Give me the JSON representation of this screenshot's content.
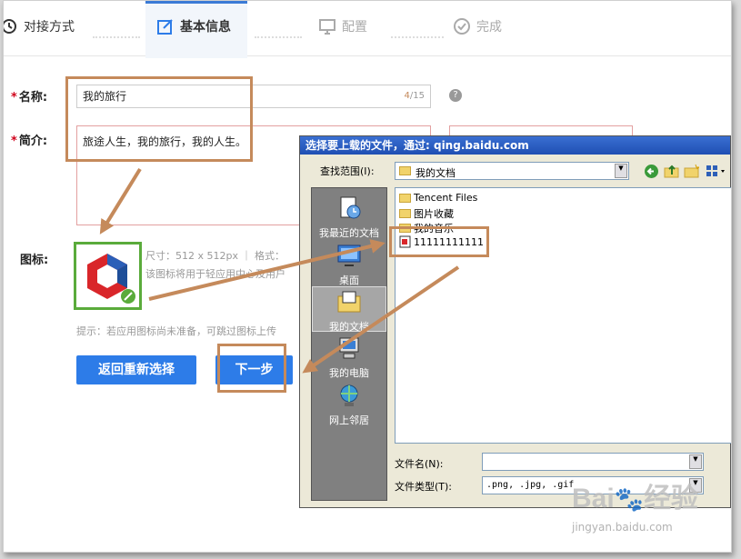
{
  "steps": [
    {
      "label": "对接方式",
      "state": "done",
      "icon": "history-icon"
    },
    {
      "label": "基本信息",
      "state": "active",
      "icon": "edit-icon"
    },
    {
      "label": "配置",
      "state": "pending",
      "icon": "monitor-icon"
    },
    {
      "label": "完成",
      "state": "pending",
      "icon": "check-circle-icon"
    }
  ],
  "form": {
    "name_label": "名称:",
    "name_value": "我的旅行",
    "name_count": "4",
    "name_max": "/15",
    "intro_label": "简介:",
    "intro_value": "旅途人生，我的旅行，我的人生。",
    "icon_label": "图标:",
    "icon_size_text": "尺寸：512 x 512px ｜ 格式：",
    "icon_desc": "该图标将用于轻应用中心及用户",
    "tip": "提示：若应用图标尚未准备，可跳过图标上传",
    "back_button": "返回重新选择",
    "next_button": "下一步"
  },
  "dialog": {
    "title": "选择要上载的文件，通过: qing.baidu.com",
    "lookin_label": "查找范围(I):",
    "lookin_value": "我的文档",
    "places": [
      "我最近的文档",
      "桌面",
      "我的文档",
      "我的电脑",
      "网上邻居"
    ],
    "files": [
      "Tencent Files",
      "图片收藏",
      "我的音乐",
      "11111111111"
    ],
    "filename_label": "文件名(N):",
    "filename_value": "",
    "filetype_label": "文件类型(T):",
    "filetype_value": ".png, .jpg, .gif"
  },
  "watermark": {
    "brand": "Bai",
    "brand2": "经验",
    "url": "jingyan.baidu.com"
  },
  "colors": {
    "accent": "#2d7ce8",
    "annotation": "#c58a5b",
    "required": "#d0021b",
    "icon_green": "#5aab3b"
  }
}
